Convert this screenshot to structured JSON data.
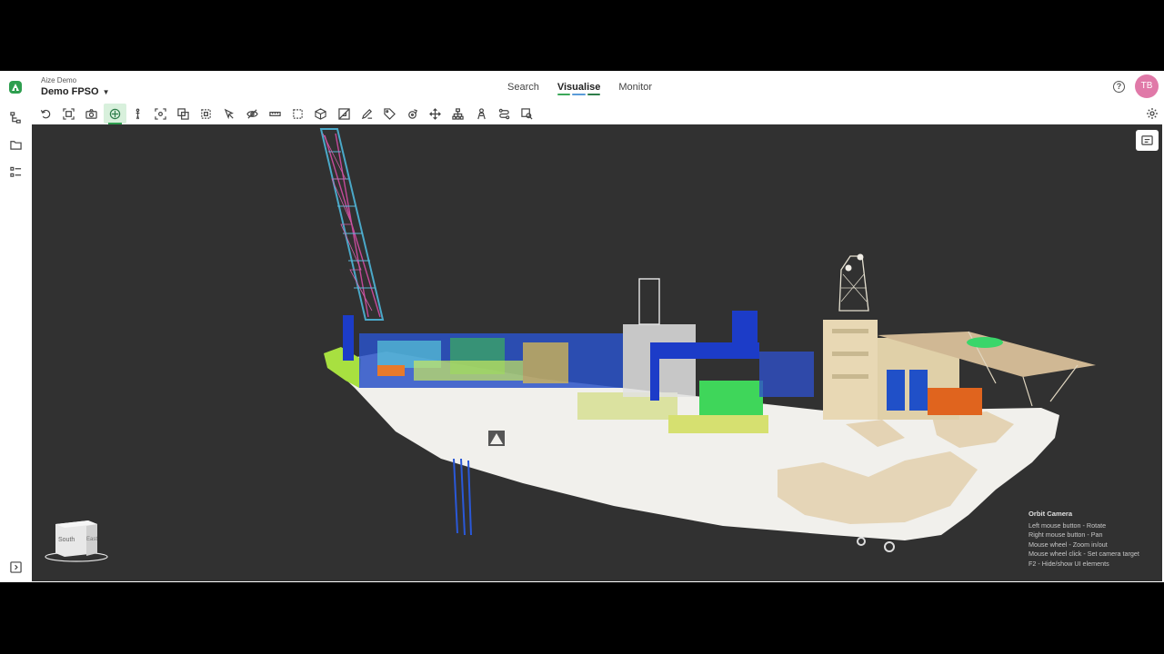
{
  "header": {
    "org_name": "Aize Demo",
    "project_name": "Demo FPSO",
    "nav_tabs": [
      {
        "label": "Search",
        "active": false
      },
      {
        "label": "Visualise",
        "active": true
      },
      {
        "label": "Monitor",
        "active": false
      }
    ],
    "active_indicator_colors": [
      "#3ca85a",
      "#5a9bd8",
      "#2e7d4a"
    ],
    "user_initials": "TB",
    "avatar_color": "#e079a8"
  },
  "toolbar": {
    "icons": [
      "undo-icon",
      "fit-view-icon",
      "camera-icon",
      "orbit-target-icon",
      "walk-icon",
      "focus-icon",
      "clone-icon",
      "select-box-icon",
      "cursor-select-icon",
      "hide-eye-icon",
      "measure-icon",
      "clip-box-icon",
      "cube-icon",
      "section-icon",
      "pen-markup-icon",
      "tag-icon",
      "rotate-object-icon",
      "move-icon",
      "hierarchy-icon",
      "person-icon",
      "route-icon",
      "search-zoom-icon"
    ],
    "active_tool": "orbit-target-icon",
    "accent": "#2e9e4f"
  },
  "left_rail": {
    "icons": [
      "model-tree-icon",
      "folder-icon",
      "list-icon",
      "expand-panel-icon"
    ]
  },
  "viewport": {
    "background": "#313131",
    "nav_cube": {
      "faces": [
        "South",
        "East"
      ]
    },
    "help": {
      "title": "Orbit Camera",
      "lines": [
        "Left mouse button - Rotate",
        "Right mouse button - Pan",
        "Mouse wheel - Zoom in/out",
        "Mouse wheel click - Set camera target",
        "F2 - Hide/show UI elements"
      ]
    }
  }
}
